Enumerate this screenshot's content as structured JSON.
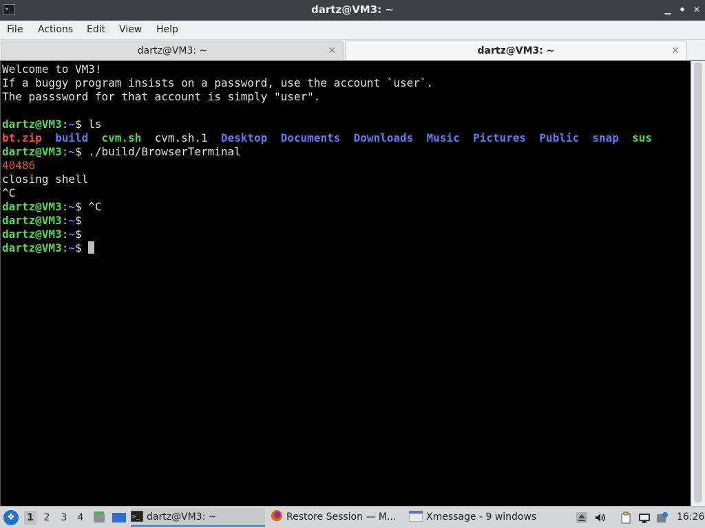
{
  "window": {
    "title": "dartz@VM3: ~",
    "app_icon_text": ">_",
    "minimize_glyph": "▁",
    "maximize_glyph": "◆",
    "close_glyph": "✕"
  },
  "menu": {
    "file": "File",
    "actions": "Actions",
    "edit": "Edit",
    "view": "View",
    "help": "Help"
  },
  "tabs": [
    {
      "label": "dartz@VM3: ~",
      "close": "✕"
    },
    {
      "label": "dartz@VM3: ~",
      "close": "✕"
    }
  ],
  "terminal": {
    "welcome": "Welcome to VM3!",
    "hint1": "If a buggy program insists on a password, use the account `user`.",
    "hint2": "The passsword for that account is simply \"user\".",
    "prompt_user": "dartz@VM3",
    "prompt_sep": ":",
    "prompt_path": "~",
    "prompt_dollar": "$ ",
    "cmd_ls": "ls",
    "ls": {
      "f1": "bt.zip",
      "f2": "build",
      "f3": "cvm.sh",
      "f4": "cvm.sh.1",
      "f5": "Desktop",
      "f6": "Documents",
      "f7": "Downloads",
      "f8": "Music",
      "f9": "Pictures",
      "f10": "Public",
      "f11": "snap",
      "f12": "sus"
    },
    "cmd_run": "./build/BrowserTerminal",
    "pid": "40486",
    "closing": "closing shell",
    "ctrl_c": "^C",
    "cmd_ctrl_c": "^C"
  },
  "taskbar": {
    "workspaces": [
      "1",
      "2",
      "3",
      "4"
    ],
    "tasks": {
      "terminal": "dartz@VM3: ~",
      "firefox": "Restore Session — M...",
      "xmessage": "Xmessage - 9 windows"
    },
    "clock": "16:26"
  },
  "colors": {
    "prompt_green": "#50dc4a",
    "dir_blue": "#5b7cf5",
    "archive_red": "#ff4848",
    "pid_orange": "#d4622f"
  }
}
